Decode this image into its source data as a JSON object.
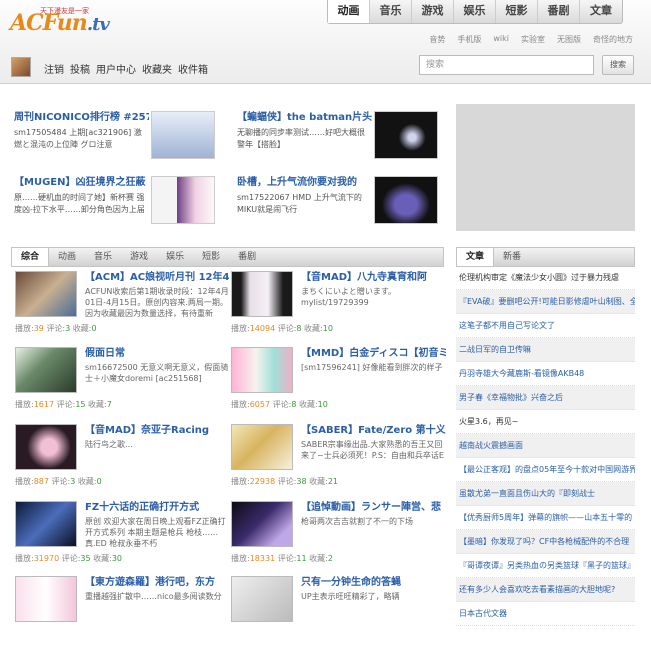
{
  "logo": {
    "main": "ACFun",
    "tv": ".tv",
    "slogan": "天下漫友是一家"
  },
  "main_tabs": [
    "动画",
    "音乐",
    "游戏",
    "娱乐",
    "短影",
    "番剧",
    "文章"
  ],
  "sub_links": [
    "音势",
    "手机版",
    "wiki",
    "实验室",
    "无图版",
    "奇怪的地方"
  ],
  "user_links": [
    "注销",
    "投稿",
    "用户中心",
    "收藏夹",
    "收件箱"
  ],
  "search": {
    "placeholder": "搜索",
    "button": "搜索"
  },
  "featured": [
    {
      "title": "周刊NICONICO排行榜 #257 4",
      "desc": "sm17505484 上期[ac321906] 激燃と混沌の上位陣 グロ注意"
    },
    {
      "title": "【蝙蝠侠】the batman片头",
      "desc": "无聊播的同步率测试……好吧大概很警年【搭脸】"
    },
    {
      "title": "【MUGEN】凶狂境界之狂蔽",
      "desc": "原……硬机血的时间了她】新杯赛 强度凶-拉下水平……卸分角色因为上届已经参加过了 所以"
    },
    {
      "title": "卧槽，上升气流你要对我的",
      "desc": "sm17522067 HMD 上升气流下的MIKU就是闹飞行"
    }
  ],
  "section_tabs": [
    "综合",
    "动画",
    "音乐",
    "游戏",
    "娱乐",
    "短影",
    "番剧"
  ],
  "stats_labels": {
    "play": "播放:",
    "comment": "评论:",
    "fav": "收藏:"
  },
  "videos": [
    {
      "title": "【ACM】AC娘视听月刊 12年4",
      "desc": "ACFUN收索后第1期收录时段：12年4月01日-4月15日。原创内容来.两局一期。因为收藏最因为数量选择，有待重新",
      "play": "39",
      "comment": "3",
      "fav": "0"
    },
    {
      "title": "【音MAD】八九寺真宵和阿",
      "desc": "まちくにいよと贈います。 mylist/19729399",
      "play": "14094",
      "comment": "8",
      "fav": "10"
    },
    {
      "title": "假面日常",
      "desc": "sm16672500 无意义啊无意义，假面骑士＋小魔女doremi [ac251568]",
      "play": "1617",
      "comment": "15",
      "fav": "7"
    },
    {
      "title": "【MMD】白金ディスコ【初音ミ",
      "desc": "[sm17596241] 好像能看到胖次的样子",
      "play": "6057",
      "comment": "8",
      "fav": "10"
    },
    {
      "title": "【音MAD】奈亚子Racing",
      "desc": "陆行鸟之歌…",
      "play": "887",
      "comment": "3",
      "fav": "0"
    },
    {
      "title": "【SABER】Fate/Zero 第十义话",
      "desc": "SABER宗事缘出品.大家熟悉的吾王又回来了~士兵必须死！P.S：自由和兵卒话E",
      "play": "22938",
      "comment": "38",
      "fav": "21"
    },
    {
      "title": "FZ十六话的正确打开方式",
      "desc": "原创 欢迎大家在周日晚上观看FZ正确打开方式系列 本期主题是枪兵 枪枝…… 真.ED 枪叔永垂不朽",
      "play": "31970",
      "comment": "35",
      "fav": "30"
    },
    {
      "title": "【追悼動画】ランサー陣営、悲",
      "desc": "枪哥两次吉吉就割了不一的下场",
      "play": "18331",
      "comment": "11",
      "fav": "2"
    },
    {
      "title": "【東方遊森羅】港行吧，东方",
      "desc": "重播越强扩散中……nico最多阅读数分",
      "play": "",
      "comment": "",
      "fav": ""
    },
    {
      "title": "只有一分钟生命的答蝇",
      "desc": "UP主表示旺旺精彩了，略辆",
      "play": "",
      "comment": "",
      "fav": ""
    }
  ],
  "side_tabs": [
    "文章",
    "新番"
  ],
  "articles": [
    "伦理机构审定《魔法少女小圆》过于暴力残虐",
    "『EVA破』要删吧公开!可能日影修虐叶山制图、全身",
    "这笔子都不用自己写论文了",
    "二战日军的自卫传嘛",
    "丹羽寺雄大今藏鹿斯-看镜像AKB48",
    "男子春《幸福物批》兴奋之后",
    "火星3.6，再见~",
    "越南战火震撼画面",
    "【最公正客观】的盘点05年至今十款对中国网游界",
    "虽散尤弟一直面且伤山大的『即刻战士",
    "【优秀厨师5周年】弹幕的旗帜——山本五十零的",
    "【墨暗】你发现了吗？CF中各枪械配件的不合理",
    "『哥谭夜谭』另类热血の另类篮球『黑子的篮球』",
    "还有多少人会喜欢吃去看素描画的大胆地呢?",
    "日本古代文器"
  ],
  "colors": {
    "link": "#2a5fa8",
    "accent": "#e8891c",
    "green": "#3a9a3a"
  }
}
